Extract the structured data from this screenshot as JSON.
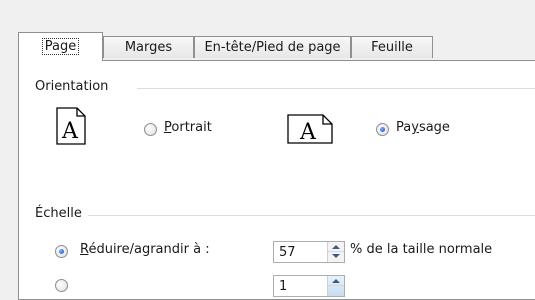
{
  "tabs": [
    {
      "label": "Page",
      "active": true
    },
    {
      "label": "Marges",
      "active": false
    },
    {
      "label": "En-tête/Pied de page",
      "active": false
    },
    {
      "label": "Feuille",
      "active": false
    }
  ],
  "orientation": {
    "group_label": "Orientation",
    "icon_letter": "A",
    "portrait": {
      "prefix": "",
      "accel": "P",
      "suffix": "ortrait",
      "selected": false
    },
    "paysage": {
      "prefix": "Pa",
      "accel": "y",
      "suffix": "sage",
      "selected": true
    }
  },
  "scaling": {
    "group_label": "Échelle",
    "reduce": {
      "accel": "R",
      "suffix": "éduire/agrandir à :",
      "selected": true,
      "value": "57",
      "unit_label": "% de la taille normale"
    },
    "fit": {
      "selected": false,
      "value": "1"
    }
  },
  "colors": {
    "radio_selected": "#0f4fbd",
    "border": "#8e8f8f",
    "separator": "#d5dfe5"
  }
}
